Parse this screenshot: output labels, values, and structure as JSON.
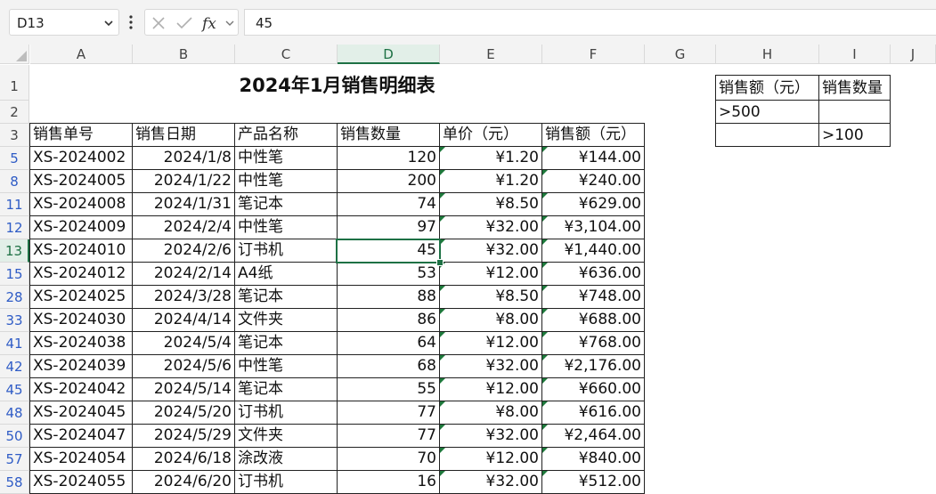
{
  "name_box": "D13",
  "formula_value": "45",
  "columns": [
    "A",
    "B",
    "C",
    "D",
    "E",
    "F",
    "G",
    "H",
    "I",
    "J"
  ],
  "selected_column": "D",
  "selected_row": "13",
  "row_labels": [
    "1",
    "2",
    "3",
    "5",
    "8",
    "11",
    "12",
    "13",
    "15",
    "28",
    "33",
    "41",
    "42",
    "45",
    "48",
    "50",
    "57",
    "58"
  ],
  "title": "2024年1月销售明细表",
  "headers": [
    "销售单号",
    "销售日期",
    "产品名称",
    "销售数量",
    "单价（元）",
    "销售额（元）"
  ],
  "rows": [
    [
      "XS-2024002",
      "2024/1/8",
      "中性笔",
      "120",
      "¥1.20",
      "¥144.00"
    ],
    [
      "XS-2024005",
      "2024/1/22",
      "中性笔",
      "200",
      "¥1.20",
      "¥240.00"
    ],
    [
      "XS-2024008",
      "2024/1/31",
      "笔记本",
      "74",
      "¥8.50",
      "¥629.00"
    ],
    [
      "XS-2024009",
      "2024/2/4",
      "中性笔",
      "97",
      "¥32.00",
      "¥3,104.00"
    ],
    [
      "XS-2024010",
      "2024/2/6",
      "订书机",
      "45",
      "¥32.00",
      "¥1,440.00"
    ],
    [
      "XS-2024012",
      "2024/2/14",
      "A4纸",
      "53",
      "¥12.00",
      "¥636.00"
    ],
    [
      "XS-2024025",
      "2024/3/28",
      "笔记本",
      "88",
      "¥8.50",
      "¥748.00"
    ],
    [
      "XS-2024030",
      "2024/4/14",
      "文件夹",
      "86",
      "¥8.00",
      "¥688.00"
    ],
    [
      "XS-2024038",
      "2024/5/4",
      "笔记本",
      "64",
      "¥12.00",
      "¥768.00"
    ],
    [
      "XS-2024039",
      "2024/5/6",
      "中性笔",
      "68",
      "¥32.00",
      "¥2,176.00"
    ],
    [
      "XS-2024042",
      "2024/5/14",
      "笔记本",
      "55",
      "¥12.00",
      "¥660.00"
    ],
    [
      "XS-2024045",
      "2024/5/20",
      "订书机",
      "77",
      "¥8.00",
      "¥616.00"
    ],
    [
      "XS-2024047",
      "2024/5/29",
      "文件夹",
      "77",
      "¥32.00",
      "¥2,464.00"
    ],
    [
      "XS-2024054",
      "2024/6/18",
      "涂改液",
      "70",
      "¥12.00",
      "¥840.00"
    ],
    [
      "XS-2024055",
      "2024/6/20",
      "订书机",
      "16",
      "¥32.00",
      "¥512.00"
    ]
  ],
  "criteria": {
    "headers": [
      "销售额（元）",
      "销售数量"
    ],
    "row1": [
      ">500",
      ""
    ],
    "row2": [
      "",
      ">100"
    ]
  },
  "icons": {
    "name_box_dropdown": "chevron-down-icon",
    "more": "vertical-dots-icon",
    "cancel": "close-icon",
    "confirm": "check-icon",
    "function": "fx-icon",
    "fx_dropdown": "chevron-down-icon",
    "select_all": "select-all-triangle-icon"
  },
  "colors": {
    "accent": "#1e7145",
    "filtered_row_number": "#2f5cc6",
    "error_indicator": "#1e7a3c"
  }
}
